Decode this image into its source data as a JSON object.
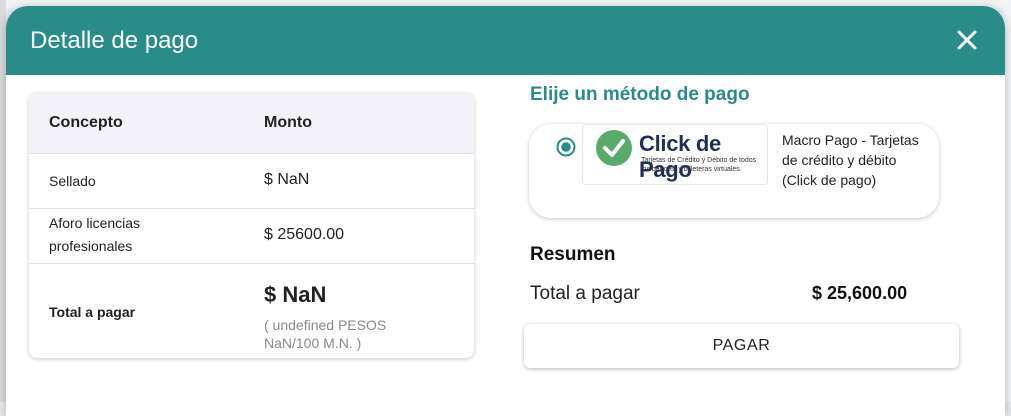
{
  "modal": {
    "title": "Detalle de pago"
  },
  "table": {
    "headers": {
      "concept": "Concepto",
      "amount": "Monto"
    },
    "rows": [
      {
        "concept": "Sellado",
        "amount": "$ NaN"
      },
      {
        "concept": "Aforo licencias profesionales",
        "amount": "$ 25600.00"
      }
    ],
    "total": {
      "label": "Total a pagar",
      "amount": "$ NaN",
      "words": "( undefined PESOS NaN/100 M.N. )"
    }
  },
  "payment": {
    "title": "Elije un método de pago",
    "method": {
      "logo_title": "Click de Pago",
      "logo_subtitle": "Tarjetas de Crédito y Débito de todos los bancos, y billeteras virtuales",
      "description": "Macro Pago - Tarjetas de crédito y débito (Click de pago)",
      "selected": true
    }
  },
  "summary": {
    "title": "Resumen",
    "total_label": "Total a pagar",
    "total_value": "$ 25,600.00"
  },
  "pay_button": {
    "label": "PAGAR"
  },
  "colors": {
    "header": "#2a8c88",
    "accent": "#2a8c88",
    "logo_check": "#5aaa6b",
    "logo_text": "#1f2f5a"
  }
}
